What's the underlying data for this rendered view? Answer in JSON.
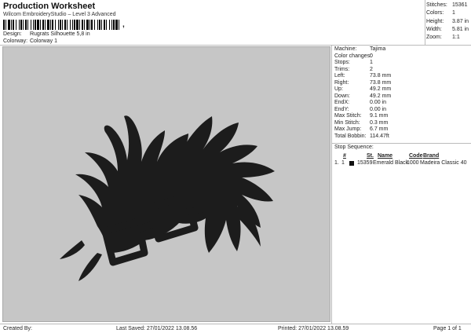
{
  "header": {
    "title": "Production Worksheet",
    "subtitle": "Wilcom EmbroideryStudio – Level 3 Advanced",
    "barcode_suffix": ","
  },
  "meta": {
    "design_label": "Design:",
    "design_value": "Rugrats Silhouette 5,8 in",
    "colorway_label": "Colorway:",
    "colorway_value": "Colorway 1"
  },
  "summary": [
    {
      "label": "Stitches:",
      "value": "15361"
    },
    {
      "label": "Colors:",
      "value": "1"
    },
    {
      "label": "Height:",
      "value": "3.87 in"
    },
    {
      "label": "Width:",
      "value": "5.81 in"
    },
    {
      "label": "Zoom:",
      "value": "1:1"
    }
  ],
  "details": [
    {
      "label": "Machine:",
      "value": "Tajima"
    },
    {
      "label": "Color changes:",
      "value": "0"
    },
    {
      "label": "Stops:",
      "value": "1"
    },
    {
      "label": "Trims:",
      "value": "2"
    },
    {
      "label": "Left:",
      "value": "73.8 mm"
    },
    {
      "label": "Right:",
      "value": "73.8 mm"
    },
    {
      "label": "Up:",
      "value": "49.2 mm"
    },
    {
      "label": "Down:",
      "value": "49.2 mm"
    },
    {
      "label": "EndX:",
      "value": "0.00 in"
    },
    {
      "label": "EndY:",
      "value": "0.00 in"
    },
    {
      "label": "Max Stitch:",
      "value": "9.1 mm"
    },
    {
      "label": "Min Stitch:",
      "value": "0.3 mm"
    },
    {
      "label": "Max Jump:",
      "value": "6.7 mm"
    },
    {
      "label": "Total Bobbin:",
      "value": "114.47ft"
    }
  ],
  "stop_sequence": {
    "title": "Stop Sequence:",
    "headers": {
      "num": "#",
      "st": "St.",
      "name": "Name",
      "code": "Code",
      "brand": "Brand"
    },
    "rows": [
      {
        "idx": "1.",
        "num": "1",
        "color": "#111111",
        "st": "15359",
        "name": "Emerald Black",
        "code": "1000",
        "brand": "Madeira Classic 40"
      }
    ]
  },
  "footer": {
    "created_by": "Created By:",
    "last_saved": "Last Saved: 27/01/2022 13.08.56",
    "printed": "Printed: 27/01/2022 13.08.59",
    "page": "Page 1 of 1"
  }
}
